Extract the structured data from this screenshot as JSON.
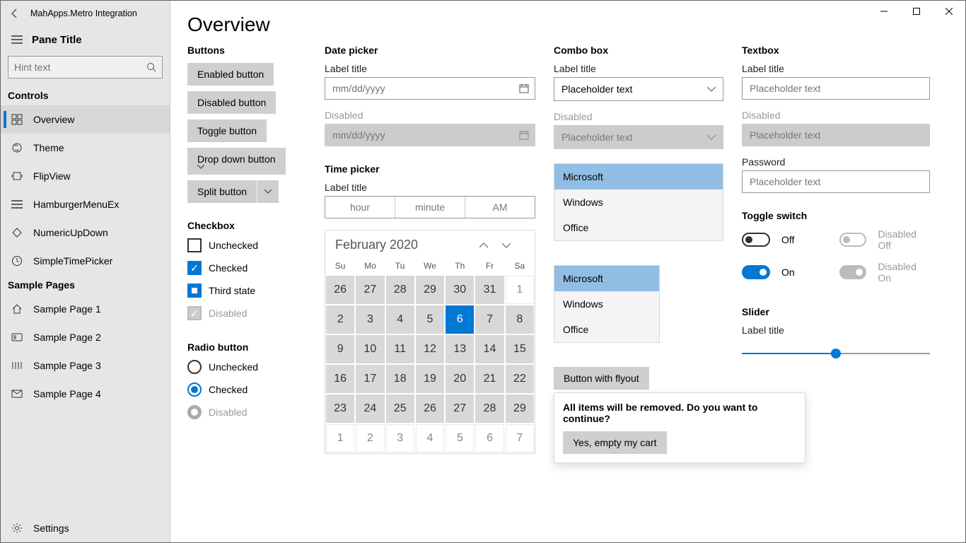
{
  "app_title": "MahApps.Metro Integration",
  "pane_title": "Pane Title",
  "search_placeholder": "Hint text",
  "nav": {
    "controls_header": "Controls",
    "items": [
      {
        "label": "Overview"
      },
      {
        "label": "Theme"
      },
      {
        "label": "FlipView"
      },
      {
        "label": "HamburgerMenuEx"
      },
      {
        "label": "NumericUpDown"
      },
      {
        "label": "SimpleTimePicker"
      }
    ],
    "sample_header": "Sample Pages",
    "samples": [
      {
        "label": "Sample Page 1"
      },
      {
        "label": "Sample Page 2"
      },
      {
        "label": "Sample Page 3"
      },
      {
        "label": "Sample Page 4"
      }
    ],
    "settings": "Settings"
  },
  "page_title": "Overview",
  "buttons": {
    "header": "Buttons",
    "enabled": "Enabled button",
    "disabled": "Disabled button",
    "toggle": "Toggle button",
    "dropdown": "Drop down button",
    "split": "Split button"
  },
  "checkbox": {
    "header": "Checkbox",
    "unchecked": "Unchecked",
    "checked": "Checked",
    "third": "Third state",
    "disabled": "Disabled"
  },
  "radio": {
    "header": "Radio button",
    "unchecked": "Unchecked",
    "checked": "Checked",
    "disabled": "Disabled"
  },
  "datepicker": {
    "header": "Date picker",
    "label": "Label title",
    "placeholder": "mm/dd/yyyy",
    "disabled_label": "Disabled"
  },
  "timepicker": {
    "header": "Time picker",
    "label": "Label title",
    "hour": "hour",
    "minute": "minute",
    "ampm": "AM"
  },
  "calendar": {
    "month": "February 2020",
    "dow": [
      "Su",
      "Mo",
      "Tu",
      "We",
      "Th",
      "Fr",
      "Sa"
    ],
    "rows": [
      [
        {
          "d": 26,
          "c": "gray"
        },
        {
          "d": 27,
          "c": "gray"
        },
        {
          "d": 28,
          "c": "gray"
        },
        {
          "d": 29,
          "c": "gray"
        },
        {
          "d": 30,
          "c": "gray"
        },
        {
          "d": 31,
          "c": "gray"
        },
        {
          "d": 1,
          "c": "out"
        }
      ],
      [
        {
          "d": 2,
          "c": "gray"
        },
        {
          "d": 3,
          "c": "gray"
        },
        {
          "d": 4,
          "c": "gray"
        },
        {
          "d": 5,
          "c": "gray"
        },
        {
          "d": 6,
          "c": "today"
        },
        {
          "d": 7,
          "c": "gray"
        },
        {
          "d": 8,
          "c": "gray"
        }
      ],
      [
        {
          "d": 9,
          "c": "gray"
        },
        {
          "d": 10,
          "c": "gray"
        },
        {
          "d": 11,
          "c": "gray"
        },
        {
          "d": 12,
          "c": "gray"
        },
        {
          "d": 13,
          "c": "gray"
        },
        {
          "d": 14,
          "c": "gray"
        },
        {
          "d": 15,
          "c": "gray"
        }
      ],
      [
        {
          "d": 16,
          "c": "gray"
        },
        {
          "d": 17,
          "c": "gray"
        },
        {
          "d": 18,
          "c": "gray"
        },
        {
          "d": 19,
          "c": "gray"
        },
        {
          "d": 20,
          "c": "gray"
        },
        {
          "d": 21,
          "c": "gray"
        },
        {
          "d": 22,
          "c": "gray"
        }
      ],
      [
        {
          "d": 23,
          "c": "gray"
        },
        {
          "d": 24,
          "c": "gray"
        },
        {
          "d": 25,
          "c": "gray"
        },
        {
          "d": 26,
          "c": "gray"
        },
        {
          "d": 27,
          "c": "gray"
        },
        {
          "d": 28,
          "c": "gray"
        },
        {
          "d": 29,
          "c": "gray"
        }
      ],
      [
        {
          "d": 1,
          "c": "out"
        },
        {
          "d": 2,
          "c": "out"
        },
        {
          "d": 3,
          "c": "out"
        },
        {
          "d": 4,
          "c": "out"
        },
        {
          "d": 5,
          "c": "out"
        },
        {
          "d": 6,
          "c": "out"
        },
        {
          "d": 7,
          "c": "out"
        }
      ]
    ]
  },
  "combo": {
    "header": "Combo box",
    "label": "Label title",
    "placeholder": "Placeholder text",
    "disabled_label": "Disabled",
    "list": [
      "Microsoft",
      "Windows",
      "Office"
    ]
  },
  "flyout": {
    "button": "Button with flyout",
    "text": "All items will be removed. Do you want to continue?",
    "confirm": "Yes, empty my cart"
  },
  "textbox": {
    "header": "Textbox",
    "label": "Label title",
    "placeholder": "Placeholder text",
    "disabled_label": "Disabled",
    "password_label": "Password"
  },
  "toggle": {
    "header": "Toggle switch",
    "off": "Off",
    "on": "On",
    "disabled_off": "Disabled Off",
    "disabled_on": "Disabled On"
  },
  "slider": {
    "header": "Slider",
    "label": "Label title",
    "value": 50
  }
}
